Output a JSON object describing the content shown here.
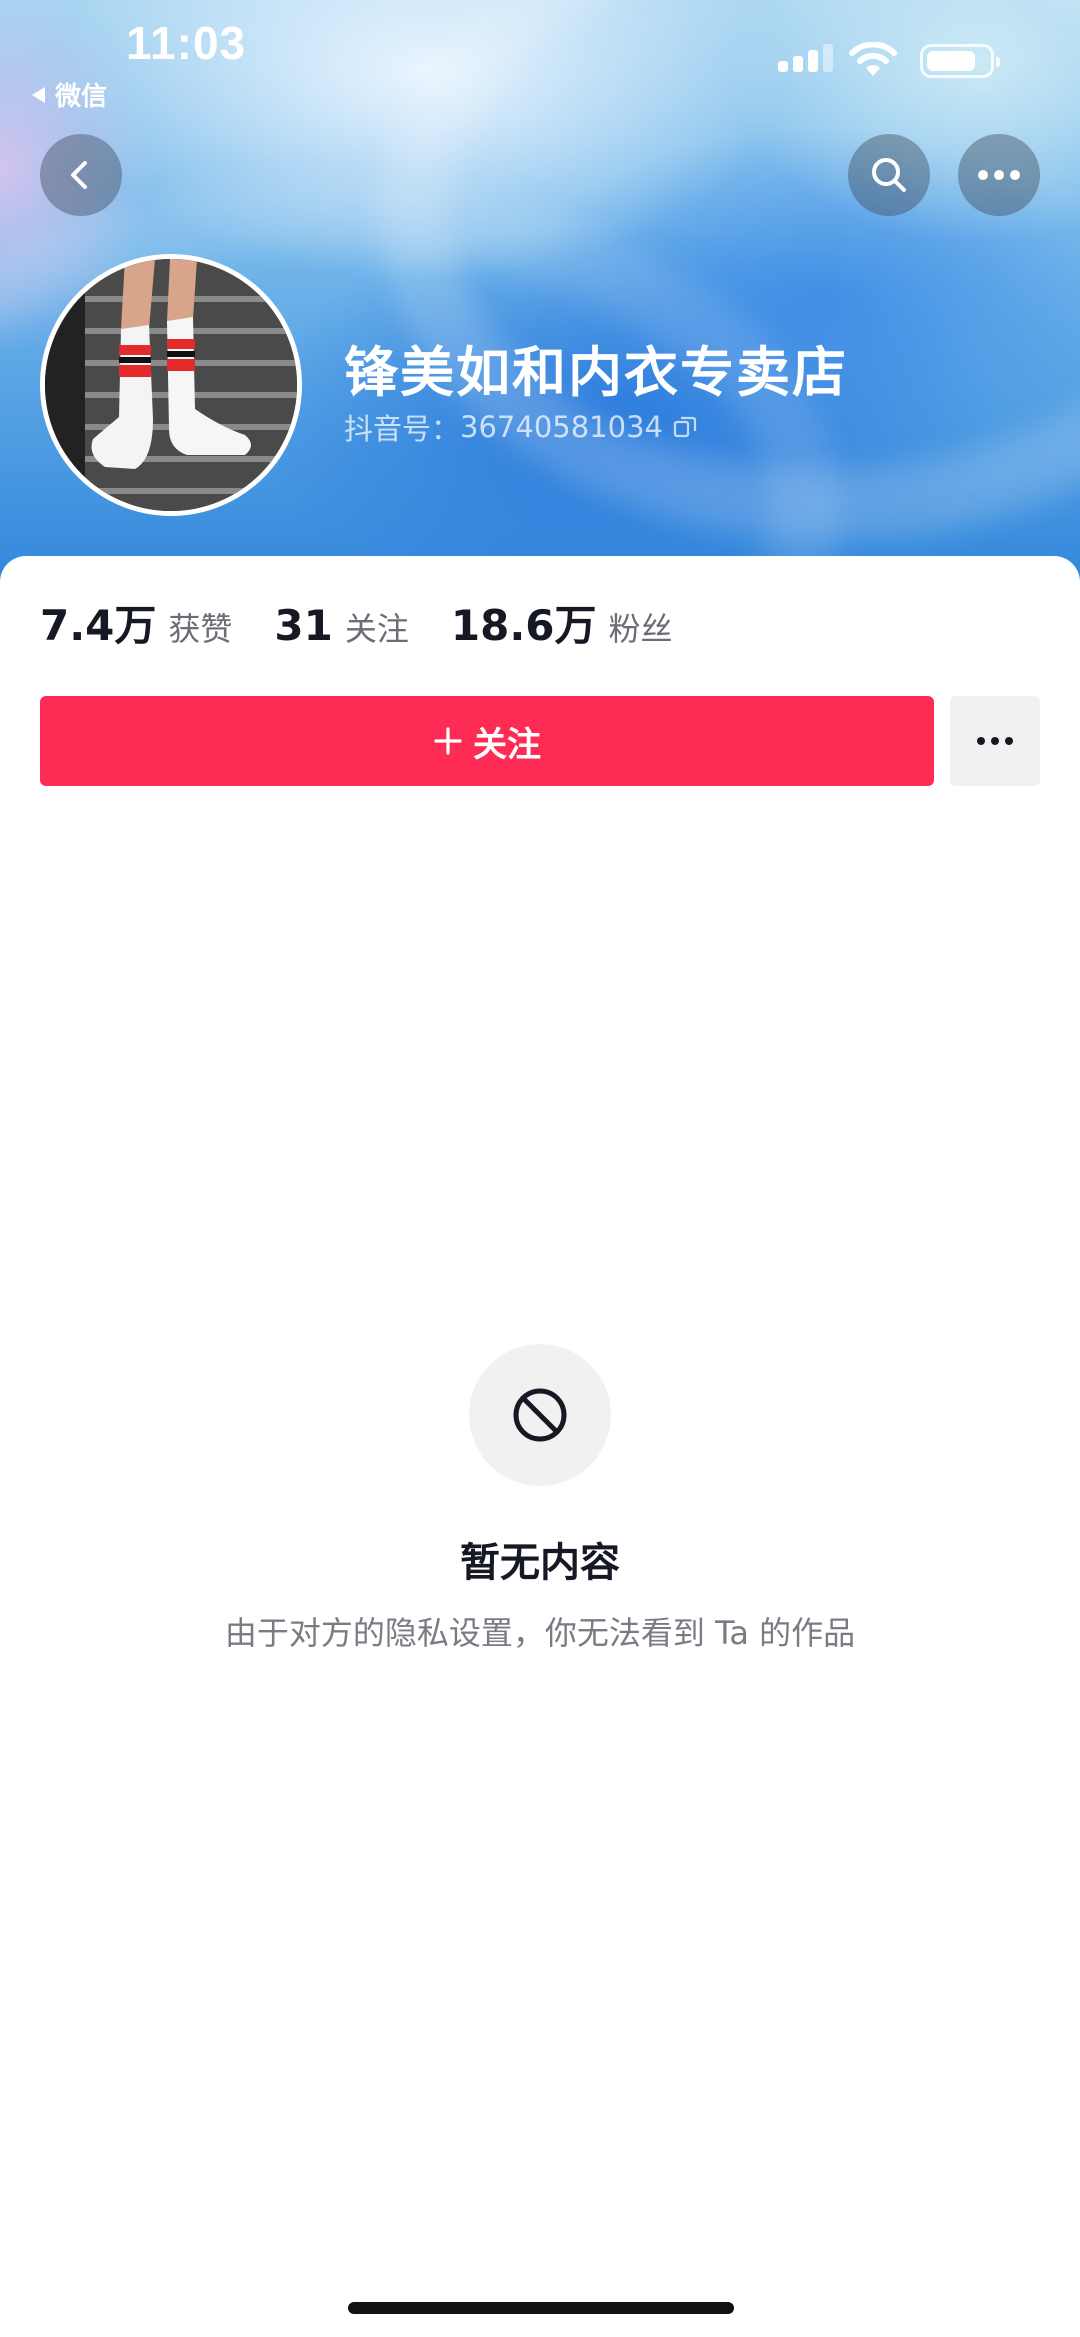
{
  "status_bar": {
    "time": "11:03",
    "back_app_label": "微信",
    "battery_level": 0.8
  },
  "nav": {
    "back_icon": "chevron-left-icon",
    "search_icon": "search-icon",
    "more_icon": "ellipsis-icon"
  },
  "profile": {
    "name": "锋美如和内衣专卖店",
    "id_label": "抖音号：",
    "id_value": "36740581034",
    "avatar_description_icon": "avatar-image"
  },
  "stats": [
    {
      "value": "7.4万",
      "label": "获赞"
    },
    {
      "value": "31",
      "label": "关注"
    },
    {
      "value": "18.6万",
      "label": "粉丝"
    }
  ],
  "actions": {
    "follow_label": "关注",
    "accent_color": "#fe2c55"
  },
  "empty_state": {
    "icon": "prohibited-icon",
    "title": "暂无内容",
    "description": "由于对方的隐私设置，你无法看到 Ta 的作品"
  }
}
